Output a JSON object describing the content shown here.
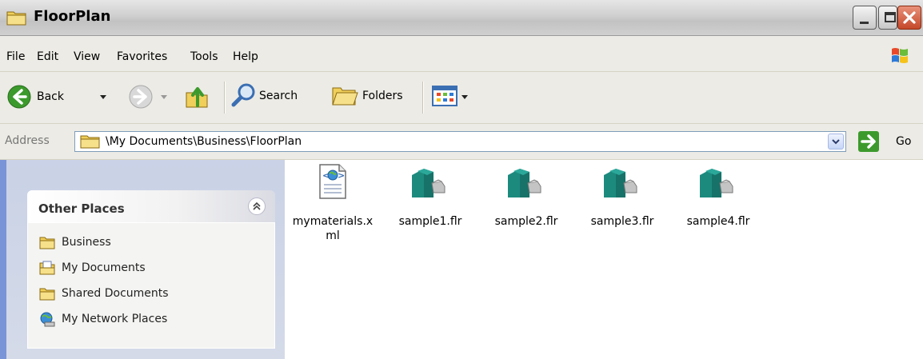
{
  "window": {
    "title": "FloorPlan"
  },
  "menu": [
    "File",
    "Edit",
    "View",
    "Favorites",
    "Tools",
    "Help"
  ],
  "toolbar": {
    "back_label": "Back",
    "search_label": "Search",
    "folders_label": "Folders"
  },
  "address": {
    "label": "Address",
    "path": "\\My Documents\\Business\\FloorPlan",
    "go_label": "Go"
  },
  "other_places": {
    "title": "Other Places",
    "items": [
      {
        "label": "Business",
        "icon": "folder-icon"
      },
      {
        "label": "My Documents",
        "icon": "my-documents-icon"
      },
      {
        "label": "Shared Documents",
        "icon": "folder-icon"
      },
      {
        "label": "My Network Places",
        "icon": "network-places-icon"
      }
    ]
  },
  "files": [
    {
      "name_line1": "mymaterials.x",
      "name_line2": "ml",
      "icon": "xml-file-icon"
    },
    {
      "name_line1": "sample1.flr",
      "name_line2": "",
      "icon": "flr-file-icon"
    },
    {
      "name_line1": "sample2.flr",
      "name_line2": "",
      "icon": "flr-file-icon"
    },
    {
      "name_line1": "sample3.flr",
      "name_line2": "",
      "icon": "flr-file-icon"
    },
    {
      "name_line1": "sample4.flr",
      "name_line2": "",
      "icon": "flr-file-icon"
    }
  ]
}
